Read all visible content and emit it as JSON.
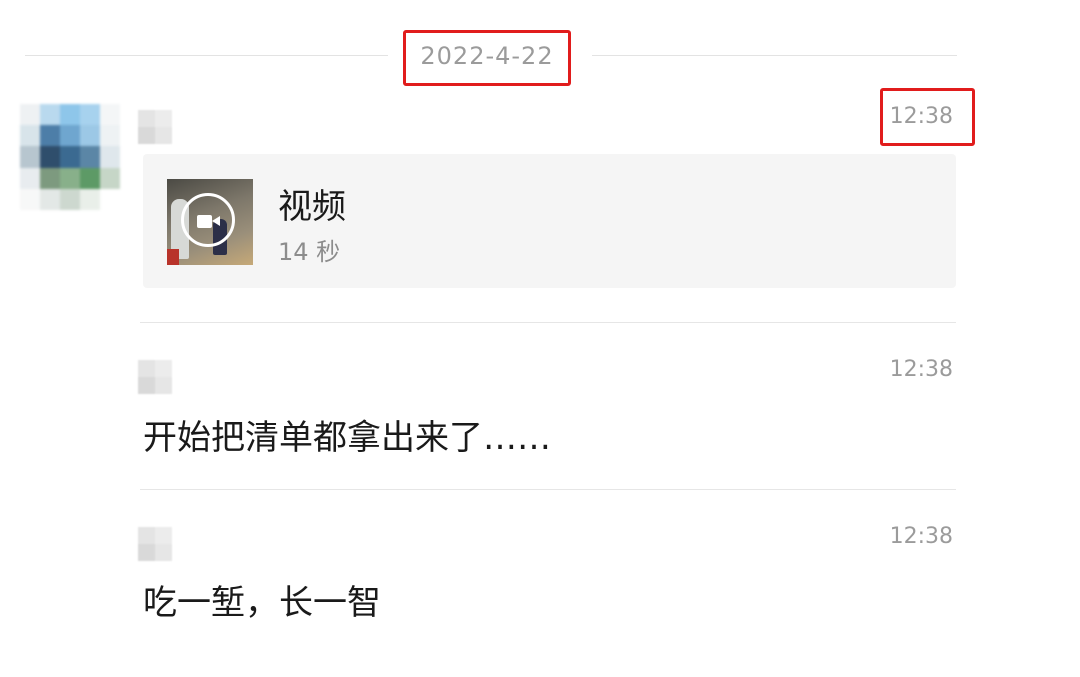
{
  "date_divider": {
    "label": "2022-4-22"
  },
  "messages": [
    {
      "kind": "video",
      "time": "12:38",
      "video": {
        "title": "视频",
        "duration": "14 秒",
        "icon": "video-camera-icon"
      }
    },
    {
      "kind": "text",
      "time": "12:38",
      "text": "开始把清单都拿出来了……"
    },
    {
      "kind": "text",
      "time": "12:38",
      "text": "吃一堑，长一智"
    }
  ],
  "colors": {
    "highlight_box": "#e11c1c",
    "muted_text": "#9b9b9b",
    "primary_text": "#1a1a1a",
    "card_background": "#f5f5f5"
  }
}
